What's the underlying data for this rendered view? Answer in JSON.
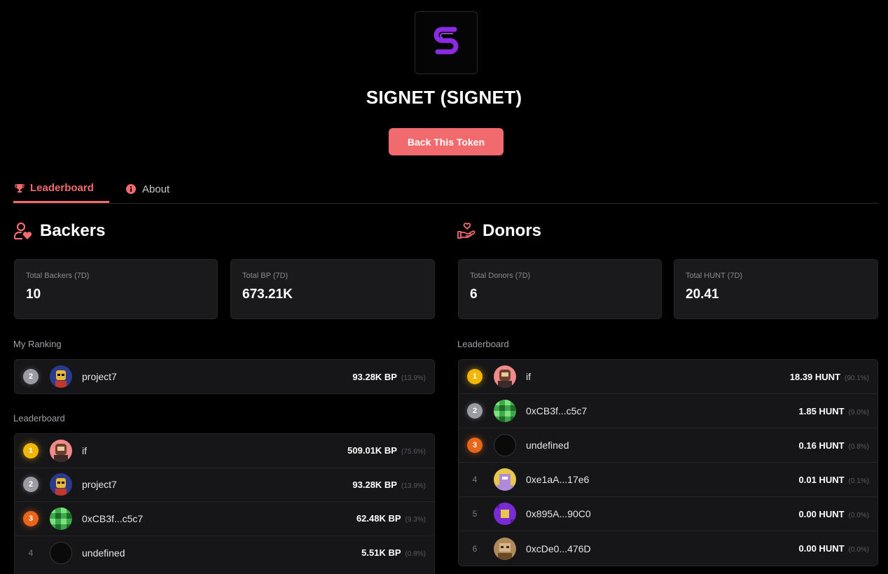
{
  "token": {
    "title": "SIGNET (SIGNET)",
    "logo_icon": "signet-s-logo",
    "logo_color": "#8a2be2",
    "back_button": "Back This Token"
  },
  "tabs": [
    {
      "label": "Leaderboard",
      "icon": "trophy-icon",
      "active": true
    },
    {
      "label": "About",
      "icon": "info-icon",
      "active": false
    }
  ],
  "accent_color": "#f16a6e",
  "backers": {
    "title": "Backers",
    "stats": [
      {
        "label": "Total Backers (7D)",
        "value": "10"
      },
      {
        "label": "Total BP (7D)",
        "value": "673.21K"
      }
    ],
    "my_ranking_label": "My Ranking",
    "my_ranking": {
      "rank": "2",
      "name": "project7",
      "amount": "93.28K BP",
      "pct": "(13.9%)"
    },
    "leaderboard_label": "Leaderboard",
    "leaderboard": [
      {
        "rank": "1",
        "name": "if",
        "amount": "509.01K BP",
        "pct": "(75.6%)"
      },
      {
        "rank": "2",
        "name": "project7",
        "amount": "93.28K BP",
        "pct": "(13.9%)"
      },
      {
        "rank": "3",
        "name": "0xCB3f...c5c7",
        "amount": "62.48K BP",
        "pct": "(9.3%)"
      },
      {
        "rank": "4",
        "name": "undefined",
        "amount": "5.51K BP",
        "pct": "(0.8%)"
      }
    ]
  },
  "donors": {
    "title": "Donors",
    "stats": [
      {
        "label": "Total Donors (7D)",
        "value": "6"
      },
      {
        "label": "Total HUNT (7D)",
        "value": "20.41"
      }
    ],
    "leaderboard_label": "Leaderboard",
    "leaderboard": [
      {
        "rank": "1",
        "name": "if",
        "amount": "18.39 HUNT",
        "pct": "(90.1%)"
      },
      {
        "rank": "2",
        "name": "0xCB3f...c5c7",
        "amount": "1.85 HUNT",
        "pct": "(9.0%)"
      },
      {
        "rank": "3",
        "name": "undefined",
        "amount": "0.16 HUNT",
        "pct": "(0.8%)"
      },
      {
        "rank": "4",
        "name": "0xe1aA...17e6",
        "amount": "0.01 HUNT",
        "pct": "(0.1%)"
      },
      {
        "rank": "5",
        "name": "0x895A...90C0",
        "amount": "0.00 HUNT",
        "pct": "(0.0%)"
      },
      {
        "rank": "6",
        "name": "0xcDe0...476D",
        "amount": "0.00 HUNT",
        "pct": "(0.0%)"
      }
    ]
  }
}
